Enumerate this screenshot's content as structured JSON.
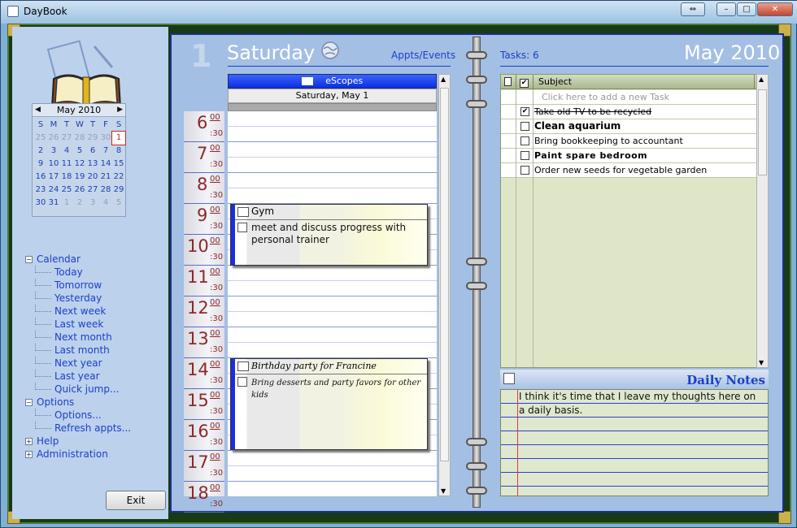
{
  "window": {
    "title": "DayBook"
  },
  "sidebar": {
    "mini_calendar": {
      "month_label": "May 2010",
      "dow": [
        "S",
        "M",
        "T",
        "W",
        "T",
        "F",
        "S"
      ],
      "weeks": [
        [
          "25",
          "26",
          "27",
          "28",
          "29",
          "30",
          "1"
        ],
        [
          "2",
          "3",
          "4",
          "5",
          "6",
          "7",
          "8"
        ],
        [
          "9",
          "10",
          "11",
          "12",
          "13",
          "14",
          "15"
        ],
        [
          "16",
          "17",
          "18",
          "19",
          "20",
          "21",
          "22"
        ],
        [
          "23",
          "24",
          "25",
          "26",
          "27",
          "28",
          "29"
        ],
        [
          "30",
          "31",
          "1",
          "2",
          "3",
          "4",
          "5"
        ]
      ],
      "selected": "1"
    },
    "tree": [
      {
        "label": "Calendar",
        "level": 0,
        "box": "−"
      },
      {
        "label": "Today",
        "level": 1
      },
      {
        "label": "Tomorrow",
        "level": 1
      },
      {
        "label": "Yesterday",
        "level": 1
      },
      {
        "label": "Next week",
        "level": 1
      },
      {
        "label": "Last week",
        "level": 1
      },
      {
        "label": "Next month",
        "level": 1
      },
      {
        "label": "Last month",
        "level": 1
      },
      {
        "label": "Next year",
        "level": 1
      },
      {
        "label": "Last year",
        "level": 1
      },
      {
        "label": "Quick jump...",
        "level": 1
      },
      {
        "label": "Options",
        "level": 0,
        "box": "−"
      },
      {
        "label": "Options...",
        "level": 1
      },
      {
        "label": "Refresh appts...",
        "level": 1
      },
      {
        "label": "Help",
        "level": 0,
        "box": "+"
      },
      {
        "label": "Administration",
        "level": 0,
        "box": "+"
      }
    ],
    "exit_label": "Exit"
  },
  "day": {
    "number": "1",
    "name": "Saturday",
    "appts_link": "Appts/Events",
    "resource": "eScopes",
    "date_label": "Saturday, May 1",
    "hours": [
      "6",
      "7",
      "8",
      "9",
      "10",
      "11",
      "12",
      "13",
      "14",
      "15",
      "16",
      "17",
      "18"
    ],
    "min_00": "00",
    "min_30": ":30",
    "appointments": [
      {
        "subject": "Gym",
        "body": "meet and discuss progress with personal trainer"
      },
      {
        "subject": "Birthday party for Francine",
        "body": "Bring desserts and party favors for other kids"
      }
    ]
  },
  "tasks": {
    "count_label": "Tasks: 6",
    "month_label": "May 2010",
    "subject_header": "Subject",
    "new_task_placeholder": "Click here to add a new Task",
    "items": [
      {
        "text": "Take old TV to be recycled",
        "done": true
      },
      {
        "text": "Clean aquarium",
        "done": false
      },
      {
        "text": "Bring bookkeeping to accountant",
        "done": false
      },
      {
        "text": "Paint spare bedroom",
        "done": false
      },
      {
        "text": "Order new seeds for vegetable garden",
        "done": false
      }
    ]
  },
  "notes": {
    "title": "Daily Notes",
    "text": "I think it's time that I leave my thoughts here on a daily basis."
  }
}
